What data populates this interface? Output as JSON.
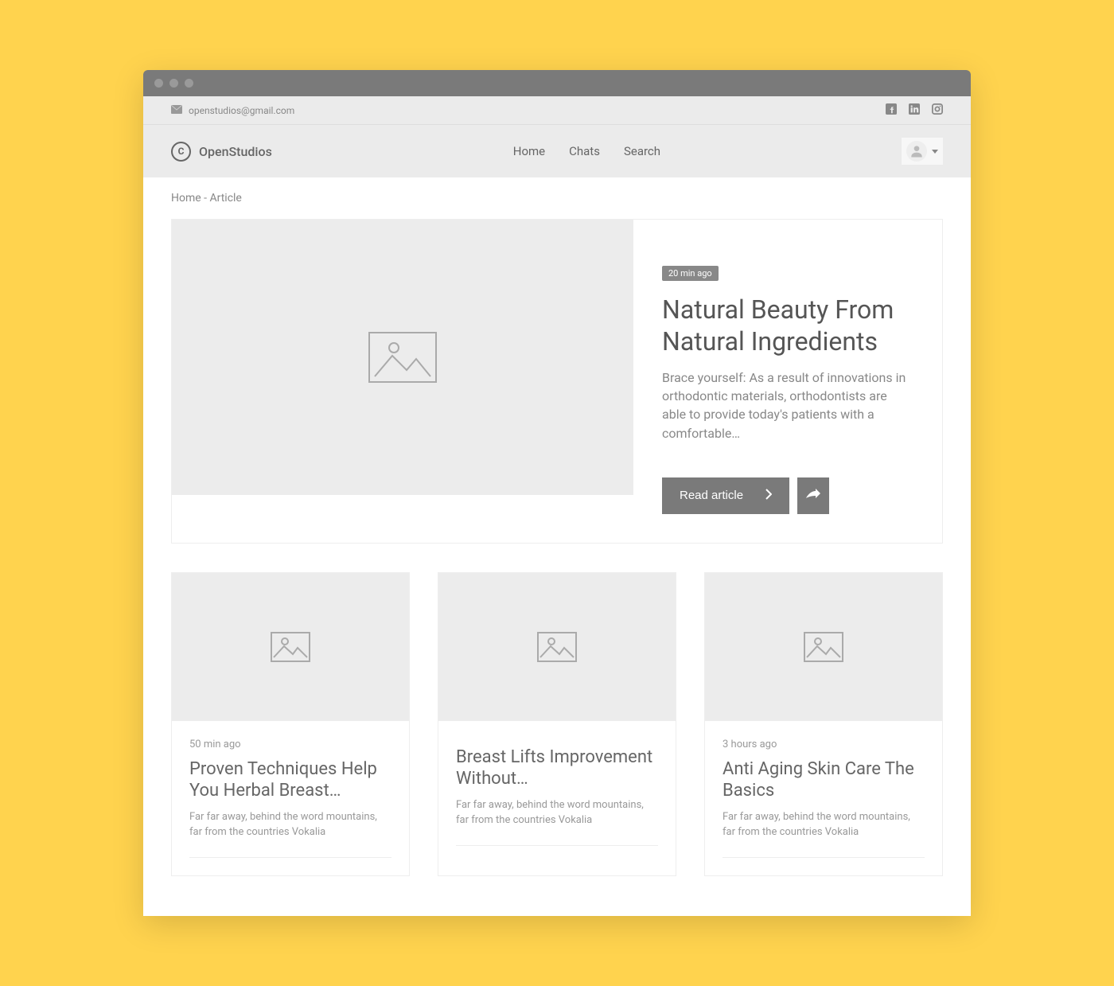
{
  "topbar": {
    "email": "openstudios@gmail.com"
  },
  "brand": {
    "logo_letter": "C",
    "name": "OpenStudios"
  },
  "nav": {
    "home": "Home",
    "chats": "Chats",
    "search": "Search"
  },
  "breadcrumb": "Home - Article",
  "featured": {
    "time": "20 min ago",
    "title": "Natural Beauty From Natural Ingredients",
    "excerpt": "Brace yourself: As a result of innovations in orthodontic materials, orthodontists are able to provide today's patients with a comfortable…",
    "read_label": "Read article"
  },
  "cards": [
    {
      "time": "50 min ago",
      "title": "Proven Techniques Help You Herbal Breast…",
      "excerpt": "Far far away, behind the word mountains, far from the countries Vokalia"
    },
    {
      "time": "",
      "title": "Breast Lifts Improvement Without…",
      "excerpt": "Far far away, behind the word mountains, far from the countries Vokalia"
    },
    {
      "time": "3 hours ago",
      "title": "Anti Aging Skin Care The Basics",
      "excerpt": "Far far away, behind the word mountains, far from the countries Vokalia"
    }
  ]
}
